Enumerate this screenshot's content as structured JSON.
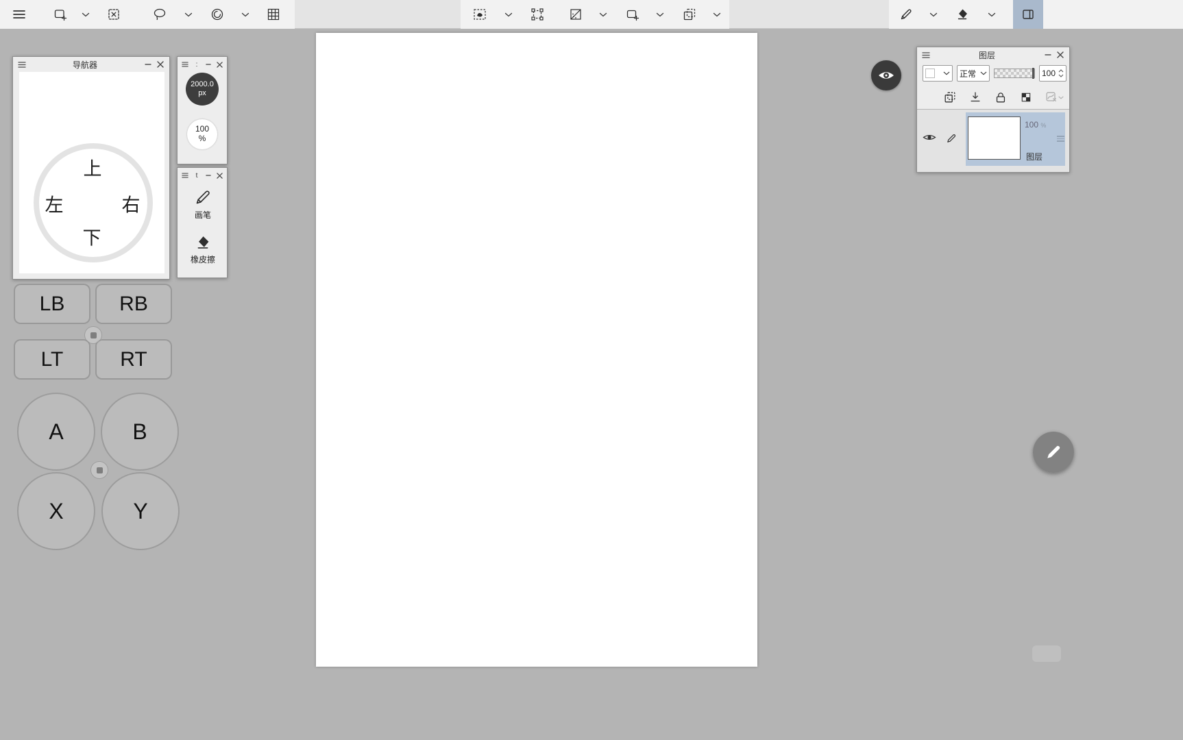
{
  "colors": {
    "background": "#b4b4b4",
    "toolbar_highlight": "#a9b9cc",
    "layer_selected_highlight": "#b5c6da"
  },
  "navigator_panel": {
    "title": "导航器",
    "dpad": {
      "up": "上",
      "down": "下",
      "left": "左",
      "right": "右"
    }
  },
  "size_panel": {
    "title": ":",
    "brush_size_value": "2000.0",
    "brush_size_unit": "px",
    "zoom_value": "100",
    "zoom_unit": "%"
  },
  "tools_panel": {
    "title": "t",
    "brush_label": "画笔",
    "eraser_label": "橡皮擦"
  },
  "gamepad": {
    "lb": "LB",
    "rb": "RB",
    "lt": "LT",
    "rt": "RT",
    "a": "A",
    "b": "B",
    "x": "X",
    "y": "Y"
  },
  "layers_panel": {
    "title": "图层",
    "blend_mode": "正常",
    "opacity_value": "100",
    "layer": {
      "opacity": "100",
      "opacity_unit": "%",
      "name": "图层"
    }
  }
}
